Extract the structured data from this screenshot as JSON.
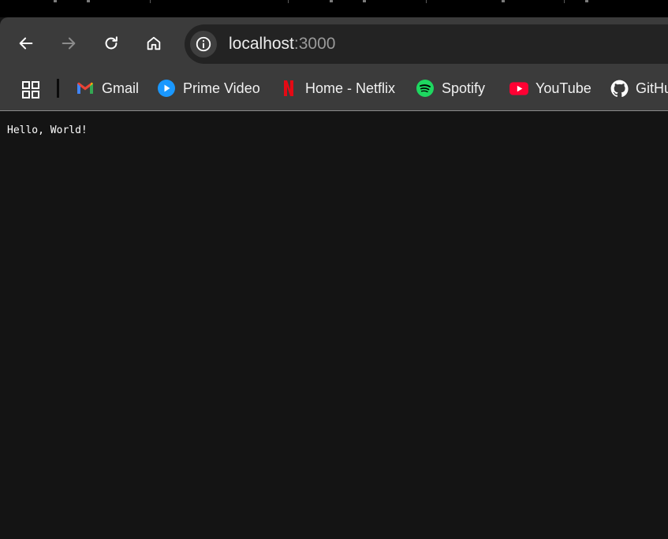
{
  "toolbar": {
    "address": {
      "host": "localhost",
      "port": ":3000"
    }
  },
  "bookmarks": [
    {
      "label": "Gmail",
      "icon": "gmail-icon"
    },
    {
      "label": "Prime Video",
      "icon": "prime-video-icon"
    },
    {
      "label": "Home - Netflix",
      "icon": "netflix-icon"
    },
    {
      "label": "Spotify",
      "icon": "spotify-icon"
    },
    {
      "label": "YouTube",
      "icon": "youtube-icon"
    },
    {
      "label": "GitHu",
      "icon": "github-icon"
    }
  ],
  "page": {
    "text": "Hello, World!"
  },
  "colors": {
    "background": "#141414",
    "chrome": "#3b3b3b",
    "omnibox": "#232323",
    "spotify": "#1ed760",
    "youtube": "#ff0033",
    "prime": "#1a98ff",
    "netflix": "#e50914"
  }
}
